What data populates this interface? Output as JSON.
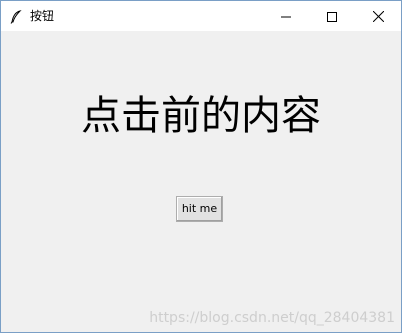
{
  "window": {
    "title": "按钮",
    "icon": "feather-icon",
    "controls": {
      "minimize_icon": "minimize-icon",
      "maximize_icon": "maximize-icon",
      "close_icon": "close-icon"
    }
  },
  "content": {
    "label_text": "点击前的内容",
    "button_label": "hit me"
  },
  "watermark": {
    "text": "https://blog.csdn.net/qq_28404381"
  },
  "colors": {
    "titlebar_bg": "#ffffff",
    "client_bg": "#f0f0f0",
    "button_bg": "#e1e1e1",
    "border_accent": "#7a9fc6"
  }
}
